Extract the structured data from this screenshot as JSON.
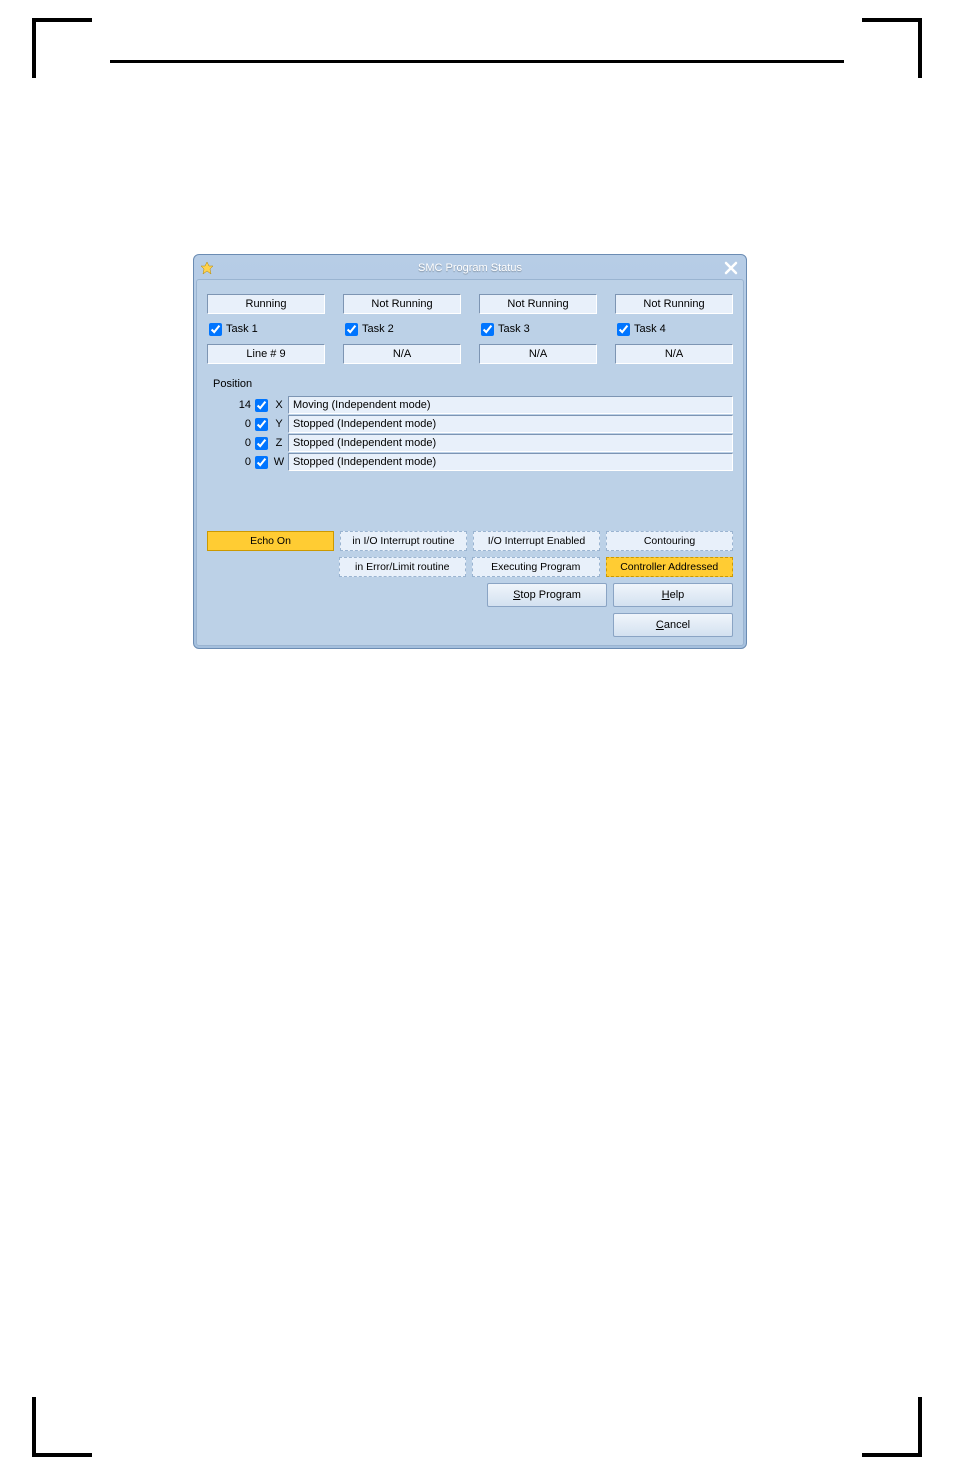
{
  "window": {
    "title": "SMC Program Status"
  },
  "tasks": [
    {
      "status": "Running",
      "label": "Task 1",
      "line": "Line # 9"
    },
    {
      "status": "Not Running",
      "label": "Task 2",
      "line": "N/A"
    },
    {
      "status": "Not Running",
      "label": "Task 3",
      "line": "N/A"
    },
    {
      "status": "Not Running",
      "label": "Task 4",
      "line": "N/A"
    }
  ],
  "position_label": "Position",
  "axes": [
    {
      "pos": "14",
      "letter": "X",
      "status": "Moving (Independent mode)"
    },
    {
      "pos": "0",
      "letter": "Y",
      "status": "Stopped (Independent mode)"
    },
    {
      "pos": "0",
      "letter": "Z",
      "status": "Stopped (Independent mode)"
    },
    {
      "pos": "0",
      "letter": "W",
      "status": "Stopped (Independent mode)"
    }
  ],
  "flags1": {
    "echo": "Echo On",
    "io": "in I/O Interrupt routine",
    "ioen": "I/O Interrupt Enabled",
    "cont": "Contouring"
  },
  "flags2": {
    "err": "in Error/Limit routine",
    "exec": "Executing Program",
    "ctrl": "Controller Addressed"
  },
  "buttons": {
    "stop": "Stop Program",
    "help": "Help",
    "cancel": "Cancel",
    "stop_u": "S",
    "help_u": "H",
    "cancel_u": "C"
  }
}
